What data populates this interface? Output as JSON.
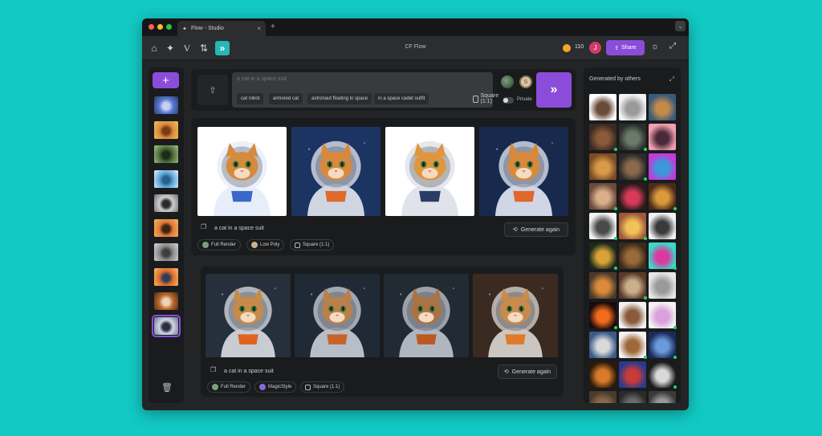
{
  "browser": {
    "tab_title": "Flow - Studio",
    "close_glyph": "×",
    "new_tab_glyph": "+",
    "tab_menu_glyph": "⌄"
  },
  "toolbar": {
    "app_title": "CF Flow",
    "credits": "110",
    "user_initial": "J",
    "share_label": "Share",
    "icons": [
      "home-icon",
      "sparkle-icon",
      "v-icon",
      "sort-icon",
      "flow-icon"
    ]
  },
  "sidebar": {
    "add_glyph": "+",
    "trash_glyph": "🗑",
    "history": [
      {
        "colors": [
          "#5a7bd6",
          "#2a3660",
          "#c9cff2"
        ]
      },
      {
        "colors": [
          "#d98a3a",
          "#f1c35b",
          "#7a3b15"
        ]
      },
      {
        "colors": [
          "#4b6b3a",
          "#a8c28a",
          "#1c2a17"
        ]
      },
      {
        "colors": [
          "#5aa6d9",
          "#e9f3ff",
          "#2a5f8c"
        ]
      },
      {
        "colors": [
          "#cfcfcf",
          "#6b6b6b",
          "#2a2a2a"
        ]
      },
      {
        "colors": [
          "#e2783a",
          "#f3b964",
          "#3a2214"
        ]
      },
      {
        "colors": [
          "#8a8a8a",
          "#d9d9d9",
          "#3e3e3e"
        ]
      },
      {
        "colors": [
          "#e06a2c",
          "#f7c26a",
          "#2c3e5a"
        ]
      },
      {
        "colors": [
          "#c46a2c",
          "#3a2a22",
          "#e8d4b8"
        ]
      },
      {
        "colors": [
          "#cfd7e8",
          "#6a7088",
          "#2a2e3c"
        ]
      }
    ],
    "selected_index": 9
  },
  "prompt": {
    "placeholder": "a cat in a space suit",
    "chips": [
      "cat robot",
      "armored cat",
      "astronaut floating in space",
      "in a space cadet outfit"
    ],
    "aspect": "Square (1:1)",
    "private_label": "Private",
    "model_b_initial": "S",
    "go_glyph": "»",
    "upload_glyph": "⇧"
  },
  "results": [
    {
      "prompt": "a cat in a space suit",
      "regen_label": "Generate again",
      "tags": [
        "Full Render",
        "Low Poly",
        "Square (1:1)"
      ],
      "images": [
        {
          "bg": "#ffffff",
          "suit": "#e8eef9",
          "accent": "#3a67c8",
          "fur": "#d58a3c"
        },
        {
          "bg": "#1c3462",
          "suit": "#cfd6e2",
          "accent": "#e06a2c",
          "fur": "#d9883c"
        },
        {
          "bg": "#ffffff",
          "suit": "#e0e4ea",
          "accent": "#2a3c66",
          "fur": "#e0963f"
        },
        {
          "bg": "#172a4e",
          "suit": "#d0d6e6",
          "accent": "#e2672a",
          "fur": "#d88a3a"
        }
      ]
    },
    {
      "prompt": "a cat in a space suit",
      "regen_label": "Generate again",
      "tags": [
        "Full Render",
        "MagicStyle",
        "Square (1:1)"
      ],
      "images": [
        {
          "bg": "#26303c",
          "suit": "#c9ccd2",
          "accent": "#e0641f",
          "fur": "#c78a4a"
        },
        {
          "bg": "#1f2a36",
          "suit": "#b8bec8",
          "accent": "#c8642a",
          "fur": "#b9804a"
        },
        {
          "bg": "#222a33",
          "suit": "#b0b6c0",
          "accent": "#b85a22",
          "fur": "#a87444"
        },
        {
          "bg": "#3a2a22",
          "suit": "#cbc6c0",
          "accent": "#e07a2a",
          "fur": "#c98a4c"
        }
      ]
    }
  ],
  "others": {
    "title": "Generated by others",
    "thumbs": [
      {
        "c1": "#ffffff",
        "c2": "#6a4a3a"
      },
      {
        "c1": "#f2f2f2",
        "c2": "#9a9a9a"
      },
      {
        "c1": "#3a5a7a",
        "c2": "#c48a4a"
      },
      {
        "c1": "#3a2a22",
        "c2": "#8a5a3a"
      },
      {
        "c1": "#2a2e2a",
        "c2": "#6a7a6a"
      },
      {
        "c1": "#f0a0b0",
        "c2": "#4a2a3a"
      },
      {
        "c1": "#7a4a22",
        "c2": "#d99a4a"
      },
      {
        "c1": "#2a2a2a",
        "c2": "#8a6a4a"
      },
      {
        "c1": "#c33ad9",
        "c2": "#3a9ad9"
      },
      {
        "c1": "#6a4a3a",
        "c2": "#d9b08a"
      },
      {
        "c1": "#2a1a1a",
        "c2": "#d93a5a"
      },
      {
        "c1": "#4a2a1a",
        "c2": "#d99a3a"
      },
      {
        "c1": "#f2f2f2",
        "c2": "#4a4a4a"
      },
      {
        "c1": "#a0583a",
        "c2": "#f2c25a"
      },
      {
        "c1": "#f2f2f2",
        "c2": "#3a3a3a"
      },
      {
        "c1": "#1a2a1a",
        "c2": "#d9a23a"
      },
      {
        "c1": "#3a2a1a",
        "c2": "#9a6a3a"
      },
      {
        "c1": "#3ad9c9",
        "c2": "#d93aa0"
      },
      {
        "c1": "#4a3a2a",
        "c2": "#d98a3a"
      },
      {
        "c1": "#5a3a2a",
        "c2": "#c9b08a"
      },
      {
        "c1": "#e6e6e6",
        "c2": "#9a9a9a"
      },
      {
        "c1": "#1a0a0a",
        "c2": "#f26a1a"
      },
      {
        "c1": "#f2f2f2",
        "c2": "#8a5a3a"
      },
      {
        "c1": "#f2f2f2",
        "c2": "#d9a0d9"
      },
      {
        "c1": "#3a5a8a",
        "c2": "#d9d9d9"
      },
      {
        "c1": "#f2f2f2",
        "c2": "#a0683a"
      },
      {
        "c1": "#1a2a5a",
        "c2": "#6a9ad9"
      },
      {
        "c1": "#2a1a0a",
        "c2": "#d97a2a"
      },
      {
        "c1": "#2a3a8a",
        "c2": "#c93a3a"
      },
      {
        "c1": "#1a1a1a",
        "c2": "#d9d9d9"
      },
      {
        "c1": "#4a3a2a",
        "c2": "#8a6a4a"
      },
      {
        "c1": "#2a2a2a",
        "c2": "#6a6a6a"
      },
      {
        "c1": "#3a3a3a",
        "c2": "#9a9a9a"
      }
    ]
  }
}
